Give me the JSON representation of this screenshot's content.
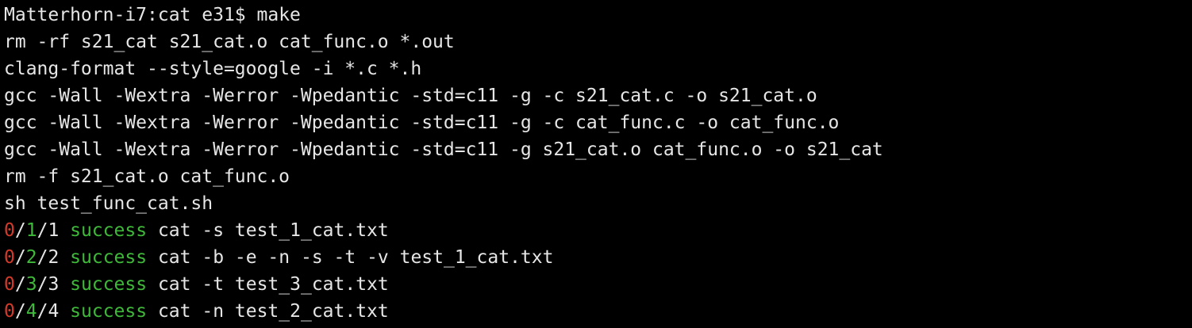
{
  "colors": {
    "background": "#000000",
    "text": "#e6e6e6",
    "fail_count": "#d23a2a",
    "success": "#3fb93a"
  },
  "terminal": {
    "prompt": "Matterhorn-i7:cat e31$ ",
    "command": "make",
    "output_lines": [
      "rm -rf s21_cat s21_cat.o cat_func.o *.out",
      "clang-format --style=google -i *.c *.h",
      "gcc -Wall -Wextra -Werror -Wpedantic -std=c11 -g -c s21_cat.c -o s21_cat.o",
      "gcc -Wall -Wextra -Werror -Wpedantic -std=c11 -g -c cat_func.c -o cat_func.o",
      "gcc -Wall -Wextra -Werror -Wpedantic -std=c11 -g s21_cat.o cat_func.o -o s21_cat",
      "rm -f s21_cat.o cat_func.o",
      "sh test_func_cat.sh"
    ],
    "test_results": [
      {
        "fail": "0",
        "success_count": "1",
        "total": "1",
        "status": "success",
        "command": "cat -s test_1_cat.txt"
      },
      {
        "fail": "0",
        "success_count": "2",
        "total": "2",
        "status": "success",
        "command": "cat -b -e -n -s -t -v test_1_cat.txt"
      },
      {
        "fail": "0",
        "success_count": "3",
        "total": "3",
        "status": "success",
        "command": "cat -t test_3_cat.txt"
      },
      {
        "fail": "0",
        "success_count": "4",
        "total": "4",
        "status": "success",
        "command": "cat -n test_2_cat.txt"
      }
    ]
  }
}
